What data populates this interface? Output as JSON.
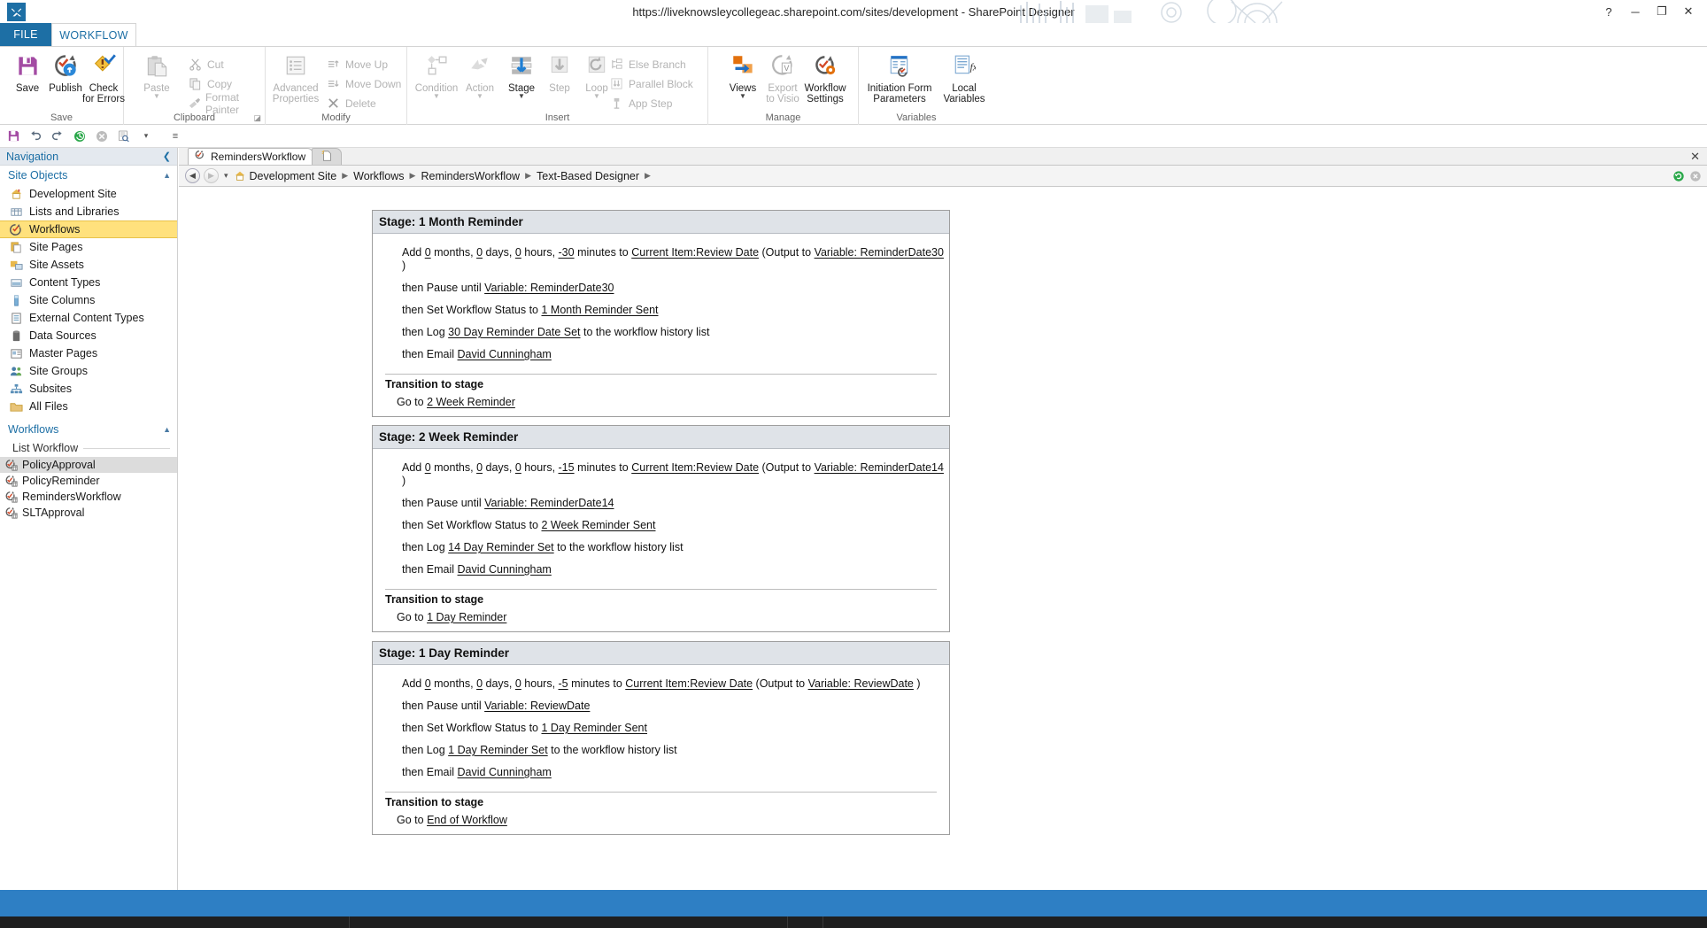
{
  "window": {
    "title": "https://liveknowsleycollegeac.sharepoint.com/sites/development - SharePoint Designer",
    "logo_glyph": "⚒",
    "help_glyph": "?",
    "minimize_glyph": "─",
    "restore_glyph": "❐",
    "close_glyph": "✕"
  },
  "tabs": {
    "file": "FILE",
    "workflow": "WORKFLOW"
  },
  "ribbon": {
    "groups": [
      {
        "name": "Save",
        "label": "Save"
      },
      {
        "name": "Clipboard",
        "label": "Clipboard"
      },
      {
        "name": "Modify",
        "label": "Modify"
      },
      {
        "name": "Insert",
        "label": "Insert"
      },
      {
        "name": "Manage",
        "label": "Manage"
      },
      {
        "name": "Variables",
        "label": "Variables"
      }
    ],
    "save": {
      "save": "Save",
      "publish": "Publish",
      "check_for_errors_line1": "Check",
      "check_for_errors_line2": "for Errors"
    },
    "clipboard": {
      "paste": "Paste",
      "cut": "Cut",
      "copy": "Copy",
      "format_painter": "Format Painter"
    },
    "modify": {
      "advanced_line1": "Advanced",
      "advanced_line2": "Properties",
      "move_up": "Move Up",
      "move_down": "Move Down",
      "delete": "Delete"
    },
    "insert": {
      "condition": "Condition",
      "action": "Action",
      "stage": "Stage",
      "step": "Step",
      "loop": "Loop",
      "else_branch": "Else Branch",
      "parallel_block": "Parallel Block",
      "app_step": "App Step"
    },
    "manage": {
      "views": "Views",
      "export_line1": "Export",
      "export_line2": "to Visio",
      "settings_line1": "Workflow",
      "settings_line2": "Settings"
    },
    "variables": {
      "initiation_line1": "Initiation Form",
      "initiation_line2": "Parameters",
      "local_line1": "Local",
      "local_line2": "Variables"
    }
  },
  "quick_access": {
    "buttons": [
      {
        "name": "save",
        "glyph": "💾"
      },
      {
        "name": "undo",
        "glyph": "↶"
      },
      {
        "name": "redo",
        "glyph": "↷"
      },
      {
        "name": "reset",
        "glyph": "⟳"
      },
      {
        "name": "stop",
        "glyph": "✖"
      },
      {
        "name": "preview",
        "glyph": "🔍"
      },
      {
        "name": "preview-dropdown",
        "glyph": "▾"
      },
      {
        "name": "customize",
        "glyph": "≡"
      }
    ]
  },
  "navigation": {
    "header": "Navigation",
    "header_collapse_glyph": "❮",
    "site_objects": {
      "label": "Site Objects",
      "collapse_glyph": "▲",
      "items": [
        {
          "label": "Development Site",
          "icon": "home-icon",
          "selected": false
        },
        {
          "label": "Lists and Libraries",
          "icon": "list-icon",
          "selected": false
        },
        {
          "label": "Workflows",
          "icon": "workflow-icon",
          "selected": true
        },
        {
          "label": "Site Pages",
          "icon": "pages-icon",
          "selected": false
        },
        {
          "label": "Site Assets",
          "icon": "assets-icon",
          "selected": false
        },
        {
          "label": "Content Types",
          "icon": "content-types-icon",
          "selected": false
        },
        {
          "label": "Site Columns",
          "icon": "columns-icon",
          "selected": false
        },
        {
          "label": "External Content Types",
          "icon": "external-content-icon",
          "selected": false
        },
        {
          "label": "Data Sources",
          "icon": "database-icon",
          "selected": false
        },
        {
          "label": "Master Pages",
          "icon": "master-pages-icon",
          "selected": false
        },
        {
          "label": "Site Groups",
          "icon": "groups-icon",
          "selected": false
        },
        {
          "label": "Subsites",
          "icon": "subsites-icon",
          "selected": false
        },
        {
          "label": "All Files",
          "icon": "folder-icon",
          "selected": false
        }
      ]
    },
    "workflows_section": {
      "label": "Workflows",
      "collapse_glyph": "▲",
      "sublabel": "List Workflow",
      "items": [
        {
          "label": "PolicyApproval",
          "selected": true
        },
        {
          "label": "PolicyReminder",
          "selected": false
        },
        {
          "label": "RemindersWorkflow",
          "selected": false
        },
        {
          "label": "SLTApproval",
          "selected": false
        }
      ]
    }
  },
  "editor": {
    "doc_tabs": [
      {
        "label": "RemindersWorkflow",
        "active": true
      },
      {
        "label": "",
        "active": false
      }
    ],
    "doc_tabs_close_glyph": "✕",
    "breadcrumb": {
      "back_glyph": "◀",
      "forward_glyph": "▶",
      "dropdown_glyph": "▾",
      "separator_glyph": "▶",
      "items": [
        "Development Site",
        "Workflows",
        "RemindersWorkflow",
        "Text-Based Designer"
      ],
      "right_icons": [
        {
          "name": "refresh-icon",
          "glyph": "↻"
        },
        {
          "name": "close-icon",
          "glyph": "✖"
        }
      ]
    }
  },
  "workflow": {
    "transition_heading": "Transition to stage",
    "goto_prefix": "Go to",
    "stages": [
      {
        "title": "Stage: 1 Month Reminder",
        "steps": [
          {
            "parts": [
              {
                "t": "Add ",
                "u": false
              },
              {
                "t": "0",
                "u": true
              },
              {
                "t": " months, ",
                "u": false
              },
              {
                "t": "0",
                "u": true
              },
              {
                "t": " days, ",
                "u": false
              },
              {
                "t": "0",
                "u": true
              },
              {
                "t": " hours, ",
                "u": false
              },
              {
                "t": "-30",
                "u": true
              },
              {
                "t": " minutes to ",
                "u": false
              },
              {
                "t": "Current Item:Review Date",
                "u": true
              },
              {
                "t": " (Output to ",
                "u": false
              },
              {
                "t": "Variable: ReminderDate30",
                "u": true
              },
              {
                "t": " )",
                "u": false
              }
            ]
          },
          {
            "parts": [
              {
                "t": "then Pause until ",
                "u": false
              },
              {
                "t": "Variable: ReminderDate30",
                "u": true
              }
            ]
          },
          {
            "parts": [
              {
                "t": "then Set Workflow Status to ",
                "u": false
              },
              {
                "t": "1 Month Reminder Sent",
                "u": true
              }
            ]
          },
          {
            "parts": [
              {
                "t": "then Log ",
                "u": false
              },
              {
                "t": "30 Day Reminder Date Set",
                "u": true
              },
              {
                "t": " to the workflow history list",
                "u": false
              }
            ]
          },
          {
            "parts": [
              {
                "t": "then Email ",
                "u": false
              },
              {
                "t": "David Cunningham",
                "u": true
              }
            ]
          }
        ],
        "goto": "2 Week Reminder"
      },
      {
        "title": "Stage: 2 Week Reminder",
        "steps": [
          {
            "parts": [
              {
                "t": "Add ",
                "u": false
              },
              {
                "t": "0",
                "u": true
              },
              {
                "t": " months, ",
                "u": false
              },
              {
                "t": "0",
                "u": true
              },
              {
                "t": " days, ",
                "u": false
              },
              {
                "t": "0",
                "u": true
              },
              {
                "t": " hours, ",
                "u": false
              },
              {
                "t": "-15",
                "u": true
              },
              {
                "t": " minutes to ",
                "u": false
              },
              {
                "t": "Current Item:Review Date",
                "u": true
              },
              {
                "t": " (Output to ",
                "u": false
              },
              {
                "t": "Variable: ReminderDate14",
                "u": true
              },
              {
                "t": " )",
                "u": false
              }
            ]
          },
          {
            "parts": [
              {
                "t": "then Pause until ",
                "u": false
              },
              {
                "t": "Variable: ReminderDate14",
                "u": true
              }
            ]
          },
          {
            "parts": [
              {
                "t": "then Set Workflow Status to ",
                "u": false
              },
              {
                "t": "2 Week Reminder Sent",
                "u": true
              }
            ]
          },
          {
            "parts": [
              {
                "t": "then Log ",
                "u": false
              },
              {
                "t": "14 Day Reminder Set",
                "u": true
              },
              {
                "t": " to the workflow history list",
                "u": false
              }
            ]
          },
          {
            "parts": [
              {
                "t": "then Email ",
                "u": false
              },
              {
                "t": "David Cunningham",
                "u": true
              }
            ]
          }
        ],
        "goto": "1 Day Reminder"
      },
      {
        "title": "Stage: 1 Day Reminder",
        "steps": [
          {
            "parts": [
              {
                "t": "Add ",
                "u": false
              },
              {
                "t": "0",
                "u": true
              },
              {
                "t": " months, ",
                "u": false
              },
              {
                "t": "0",
                "u": true
              },
              {
                "t": " days, ",
                "u": false
              },
              {
                "t": "0",
                "u": true
              },
              {
                "t": " hours, ",
                "u": false
              },
              {
                "t": "-5",
                "u": true
              },
              {
                "t": " minutes to ",
                "u": false
              },
              {
                "t": "Current Item:Review Date",
                "u": true
              },
              {
                "t": " (Output to ",
                "u": false
              },
              {
                "t": "Variable: ReviewDate",
                "u": true
              },
              {
                "t": " )",
                "u": false
              }
            ]
          },
          {
            "parts": [
              {
                "t": "then Pause until ",
                "u": false
              },
              {
                "t": "Variable: ReviewDate",
                "u": true
              }
            ]
          },
          {
            "parts": [
              {
                "t": "then Set Workflow Status to ",
                "u": false
              },
              {
                "t": "1 Day Reminder Sent",
                "u": true
              }
            ]
          },
          {
            "parts": [
              {
                "t": "then Log ",
                "u": false
              },
              {
                "t": "1 Day Reminder Set",
                "u": true
              },
              {
                "t": " to the workflow history list",
                "u": false
              }
            ]
          },
          {
            "parts": [
              {
                "t": "then Email ",
                "u": false
              },
              {
                "t": "David Cunningham",
                "u": true
              }
            ]
          }
        ],
        "goto": "End of Workflow"
      }
    ]
  },
  "colors": {
    "accent": "#1d6fa5",
    "selection_yellow": "#ffe17d",
    "stage_header": "#dfe3e8",
    "taskbar_blue": "#2e7fc4"
  }
}
